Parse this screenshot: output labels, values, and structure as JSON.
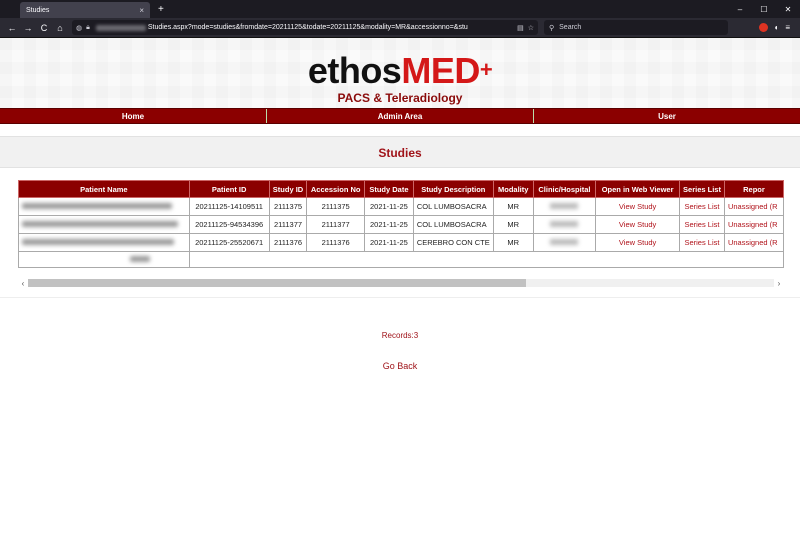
{
  "browser": {
    "tab_title": "Studies",
    "tab_close": "×",
    "new_tab": "+",
    "url": "Studies.aspx?mode=studies&fromdate=20211125&todate=20211125&modality=MR&accessionno=&stu",
    "search_placeholder": "Search",
    "win_min": "–",
    "win_max": "☐",
    "win_close": "✕",
    "back": "←",
    "forward": "→",
    "reload": "C"
  },
  "header": {
    "logo_main_1": "ethos",
    "logo_main_2": "MED",
    "logo_plus": "+",
    "logo_sub": "PACS & Teleradiology"
  },
  "nav": {
    "items": [
      {
        "label": "Home"
      },
      {
        "label": "Admin Area"
      },
      {
        "label": "User"
      }
    ]
  },
  "page": {
    "title": "Studies",
    "records": "Records:3",
    "go_back": "Go Back"
  },
  "table": {
    "headers": [
      "Patient Name",
      "Patient ID",
      "Study ID",
      "Accession No",
      "Study Date",
      "Study Description",
      "Modality",
      "Clinic/Hospital",
      "Open in Web Viewer",
      "Series List",
      "Repor"
    ],
    "rows": [
      {
        "patient_id": "20211125-14109511",
        "study_id": "2111375",
        "accession": "2111375",
        "date": "2021-11-25",
        "description": "COL LUMBOSACRA",
        "modality": "MR",
        "viewer": "View Study",
        "series": "Series List",
        "report": "Unassigned (R"
      },
      {
        "patient_id": "20211125-94534396",
        "study_id": "2111377",
        "accession": "2111377",
        "date": "2021-11-25",
        "description": "COL LUMBOSACRA",
        "modality": "MR",
        "viewer": "View Study",
        "series": "Series List",
        "report": "Unassigned (R"
      },
      {
        "patient_id": "20211125-25520671",
        "study_id": "2111376",
        "accession": "2111376",
        "date": "2021-11-25",
        "description": "CEREBRO CON CTE",
        "modality": "MR",
        "viewer": "View Study",
        "series": "Series List",
        "report": "Unassigned (R"
      }
    ]
  },
  "scrollbar": {
    "left_arrow": "‹",
    "right_arrow": "›"
  }
}
